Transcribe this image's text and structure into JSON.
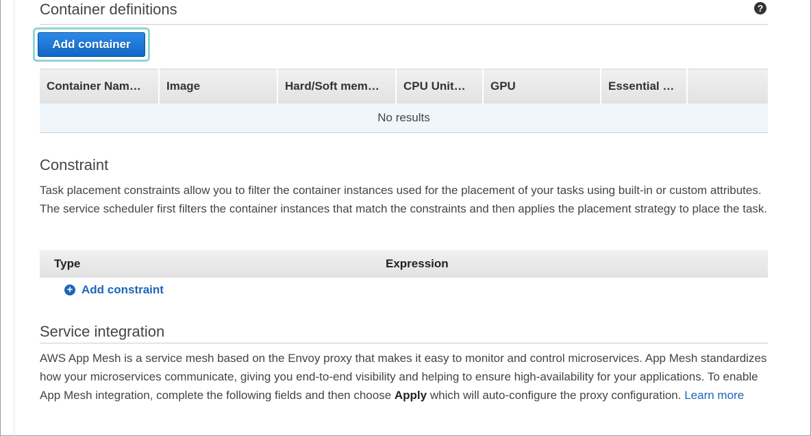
{
  "container_definitions": {
    "title": "Container definitions",
    "help_icon": "question-circle-icon",
    "add_button_label": "Add container",
    "columns": [
      "Container Nam…",
      "Image",
      "Hard/Soft mem…",
      "CPU Unit…",
      "GPU",
      "Essential …",
      ""
    ],
    "empty_message": "No results"
  },
  "constraint": {
    "title": "Constraint",
    "description": "Task placement constraints allow you to filter the container instances used for the placement of your tasks using built-in or custom attributes. The service scheduler first filters the container instances that match the constraints and then applies the placement strategy to place the task.",
    "columns": [
      "Type",
      "Expression"
    ],
    "add_label": "Add constraint",
    "add_icon": "plus-circle-icon"
  },
  "service_integration": {
    "title": "Service integration",
    "description_before": "AWS App Mesh is a service mesh based on the Envoy proxy that makes it easy to monitor and control microservices. App Mesh standardizes how your microservices communicate, giving you end-to-end visibility and helping to ensure high-availability for your applications. To enable App Mesh integration, complete the following fields and then choose ",
    "description_bold": "Apply",
    "description_after": " which will auto-configure the proxy configuration. ",
    "learn_more": "Learn more"
  },
  "colors": {
    "primary_button": "#1a74d6",
    "focus_ring": "#8fd6d6",
    "link": "#1a66b8",
    "empty_row_bg": "#eff6fc"
  }
}
